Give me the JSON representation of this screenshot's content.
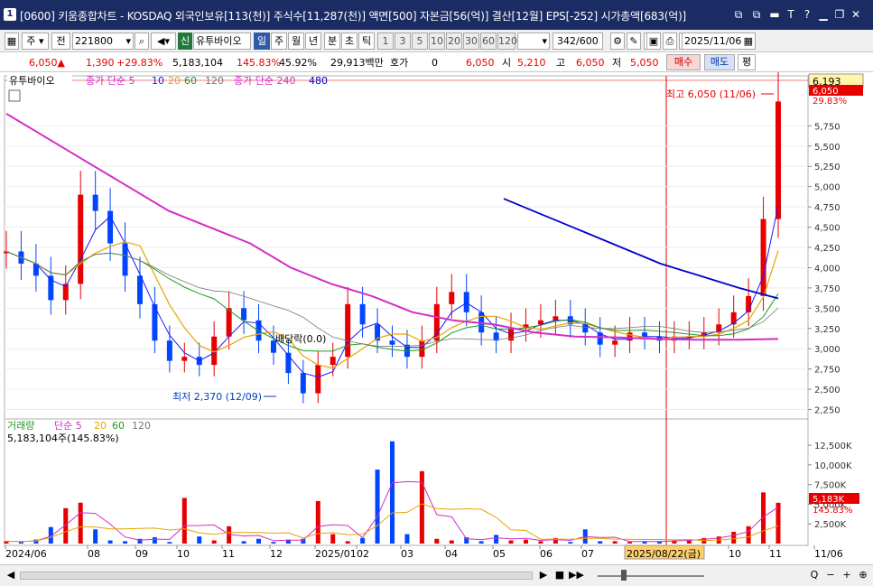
{
  "window": {
    "number": "1",
    "title": "[0600] 키움종합차트 - KOSDAQ 외국인보유[113(천)] 주식수[11,287(천)] 액면[500] 자본금[56(억)] 결산[12월] EPS[-252] 시가총액[683(억)]",
    "controls": [
      "⧉",
      "⧉",
      "▬",
      "T",
      "?",
      "▁",
      "❐",
      "✕"
    ]
  },
  "toolbar": {
    "period_unit": "주",
    "range_label": "전",
    "code": "221800",
    "badge": "신",
    "stock_name": "유투바이오",
    "period_tabs": [
      "일",
      "주",
      "월",
      "년",
      "분",
      "초",
      "틱"
    ],
    "minute_steps": [
      "1",
      "3",
      "5",
      "10",
      "20",
      "30",
      "60",
      "120"
    ],
    "count": "342",
    "count_total": "/600",
    "date": "2025/11/06"
  },
  "quote": {
    "price": "6,050",
    "arrow": "▲",
    "change": "1,390",
    "change_pct": "+29.83%",
    "volume": "5,183,104",
    "volume_ratio": "145.83%",
    "rate2": "45.92%",
    "amount": "29,913백만",
    "hoga_label": "호가",
    "hoga_val": "0",
    "hoga_price": "6,050",
    "open_label": "시",
    "open": "5,210",
    "high_label": "고",
    "high": "6,050",
    "low_label": "저",
    "low": "5,050",
    "buy": "매수",
    "sell": "매도",
    "eval": "평"
  },
  "colors": {
    "up": "#e60000",
    "down": "#0046ff",
    "ma5": "#1a1aff",
    "ma20": "#e6a400",
    "ma60": "#1f9a1f",
    "ma120": "#777777",
    "ma240": "#d22dc6",
    "ma480": "#0000cc",
    "vol": "#e60000"
  },
  "chart_data": [
    {
      "type": "candlestick",
      "legend": [
        "유투바이오",
        "종가 단순 5",
        "10",
        "20",
        "60",
        "120",
        "종가 단순 240",
        "480"
      ],
      "ylim": [
        2200,
        6300
      ],
      "y_ticks": [
        "5,750",
        "5,500",
        "5,250",
        "5,000",
        "4,750",
        "4,500",
        "4,250",
        "4,000",
        "3,750",
        "3,500",
        "3,250",
        "3,000",
        "2,750",
        "2,500",
        "2,250"
      ],
      "last_price_tag": "6,193",
      "current_price_label": "6,050",
      "current_pct_label": "29.83%",
      "annotations": [
        {
          "text": "최고 6,050 (11/06)",
          "x": "2025/11/06",
          "y": 6050
        },
        {
          "text": "최저 2,370 (12/09)",
          "x": "2024/12/09",
          "y": 2370
        },
        {
          "text": "배당락(0.0)",
          "x": "2024/12/27",
          "y": 2850
        }
      ],
      "x_ticks": [
        "2024/06",
        "08",
        "09",
        "10",
        "11",
        "12",
        "2025/01",
        "02",
        "03",
        "04",
        "05",
        "06",
        "07",
        "2025/08/22(금)",
        "10",
        "11",
        "11/06"
      ],
      "series": [
        {
          "name": "유투바이오",
          "close": [
            4200,
            4050,
            3900,
            3600,
            3800,
            4900,
            4700,
            4300,
            3900,
            3550,
            3100,
            2850,
            2900,
            2800,
            3150,
            3500,
            3350,
            3100,
            2950,
            2700,
            2450,
            2800,
            2900,
            3550,
            3300,
            3100,
            3050,
            2900,
            3100,
            3550,
            3700,
            3450,
            3200,
            3100,
            3250,
            3300,
            3350,
            3400,
            3300,
            3200,
            3050,
            3100,
            3200,
            3150,
            3100,
            3150,
            3150,
            3200,
            3300,
            3450,
            3650,
            4600,
            6050
          ]
        },
        {
          "name": "종가 단순 240",
          "values": [
            5900,
            5600,
            5300,
            5000,
            4700,
            4500,
            4300,
            4000,
            3800,
            3650,
            3450,
            3350,
            3300,
            3200,
            3150,
            3140,
            3120,
            3110,
            3110,
            3120
          ]
        },
        {
          "name": "480",
          "values": [
            4850,
            4650,
            4450,
            4250,
            4050,
            3900,
            3750,
            3620
          ]
        }
      ]
    },
    {
      "type": "bar",
      "title": "거래량",
      "legend": [
        "거래량",
        "단순 5",
        "20",
        "60",
        "120"
      ],
      "value_label": "5,183,104주(145.83%)",
      "y_ticks": [
        "12,500K",
        "10,000K",
        "7,500K",
        "5,000K",
        "2,500K"
      ],
      "ylim": [
        0,
        14000
      ],
      "last_volume_tag": "5,183K",
      "last_pct_tag": "145.83%",
      "values": [
        300,
        200,
        500,
        2100,
        4500,
        5200,
        1800,
        400,
        300,
        600,
        800,
        200,
        5800,
        900,
        400,
        2200,
        300,
        600,
        200,
        500,
        600,
        5400,
        1200,
        300,
        700,
        9400,
        13000,
        1200,
        9200,
        600,
        400,
        800,
        300,
        1100,
        400,
        500,
        300,
        700,
        200,
        1800,
        300,
        300,
        200,
        300,
        300,
        400,
        500,
        700,
        900,
        1500,
        2200,
        6500,
        5183
      ]
    }
  ],
  "statusbar": {
    "buttons": [
      "◀",
      "▶",
      "■",
      "▶▶",
      "+",
      "−",
      "Q",
      "⊕"
    ]
  }
}
